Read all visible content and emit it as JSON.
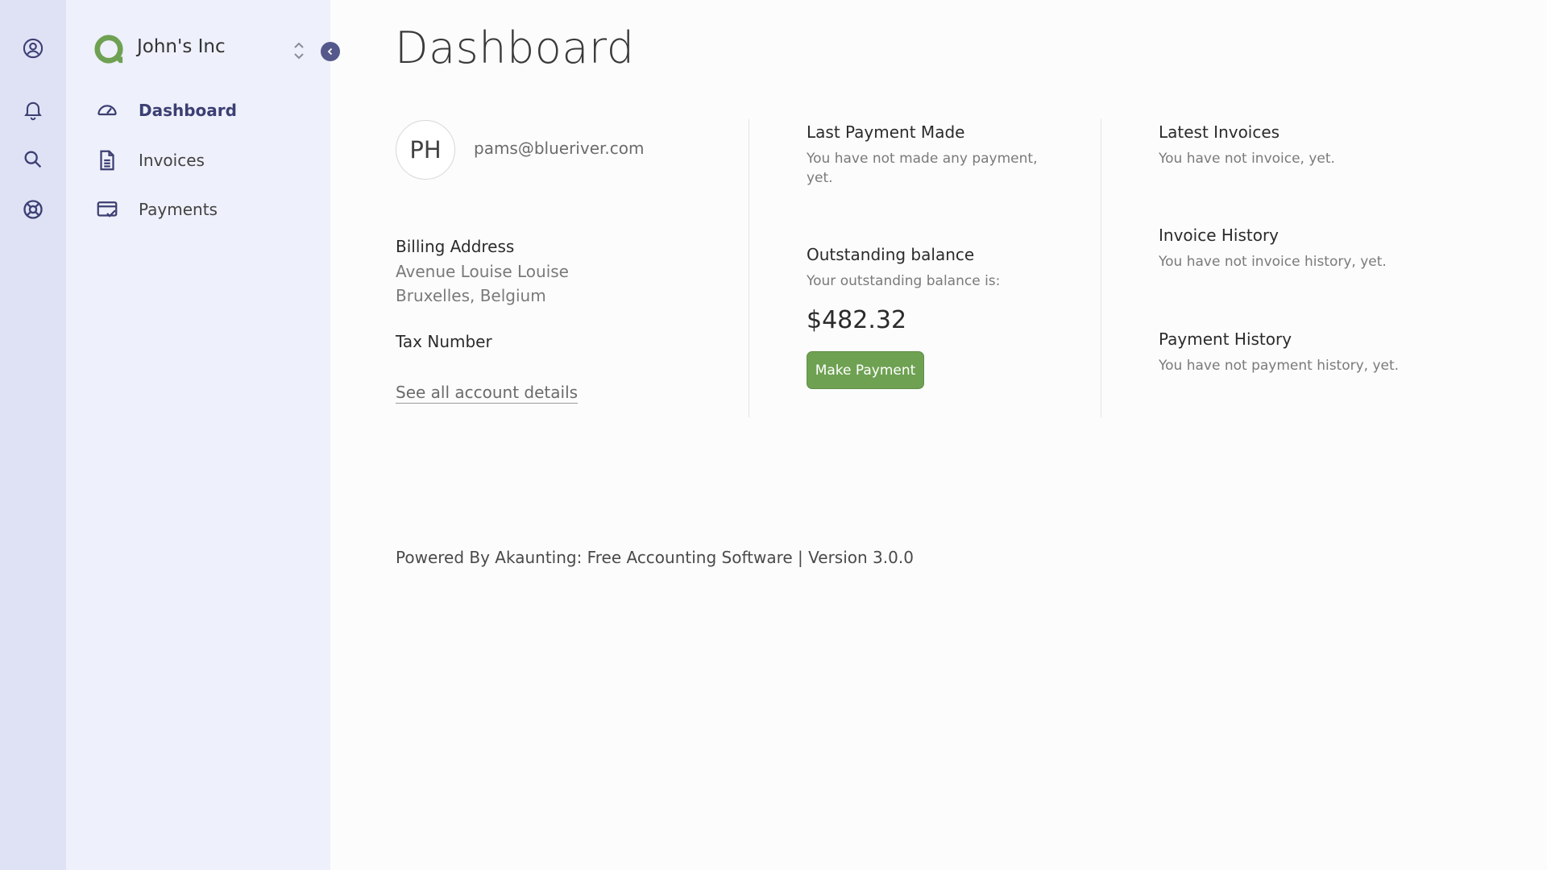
{
  "rail": {
    "icons": [
      "profile-icon",
      "bell-icon",
      "search-icon",
      "support-icon"
    ]
  },
  "sidebar": {
    "company_name": "John's Inc",
    "items": [
      {
        "label": "Dashboard",
        "icon": "gauge-icon",
        "active": true
      },
      {
        "label": "Invoices",
        "icon": "document-icon",
        "active": false
      },
      {
        "label": "Payments",
        "icon": "credit-card-icon",
        "active": false
      }
    ]
  },
  "main": {
    "title": "Dashboard",
    "profile": {
      "initials": "PH",
      "email": "pams@blueriver.com",
      "billing_heading": "Billing Address",
      "address_line1": "Avenue Louise Louise",
      "address_line2": "Bruxelles, Belgium",
      "tax_heading": "Tax Number",
      "details_link": "See all account details"
    },
    "payments": {
      "last_heading": "Last Payment Made",
      "last_text": "You have not made any payment, yet.",
      "balance_heading": "Outstanding balance",
      "balance_text": "Your outstanding balance is:",
      "balance_amount": "$482.32",
      "pay_button": "Make Payment"
    },
    "history": {
      "latest_heading": "Latest Invoices",
      "latest_text": "You have not invoice, yet.",
      "invoice_history_heading": "Invoice History",
      "invoice_history_text": "You have not invoice history, yet.",
      "payment_history_heading": "Payment History",
      "payment_history_text": "You have not payment history, yet."
    },
    "footer": "Powered By Akaunting: Free Accounting Software | Version 3.0.0"
  },
  "colors": {
    "rail_bg": "#dfe2f5",
    "sidebar_bg": "#eef0fb",
    "accent": "#55588b",
    "button_green": "#6ea152",
    "logo_green": "#6ea152"
  }
}
